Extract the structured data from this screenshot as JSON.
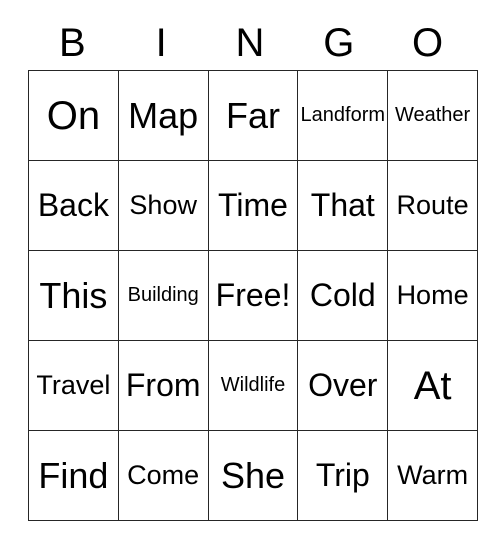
{
  "card": {
    "title": "BINGO",
    "header_letters": [
      "B",
      "I",
      "N",
      "G",
      "O"
    ],
    "border_color": "#262626",
    "background_color": "#ffffff",
    "text_color": "#000000",
    "rows": [
      [
        {
          "text": "On",
          "size": "xl"
        },
        {
          "text": "Map",
          "size": "lg"
        },
        {
          "text": "Far",
          "size": "lg"
        },
        {
          "text": "Landform",
          "size": "xs"
        },
        {
          "text": "Weather",
          "size": "xs"
        }
      ],
      [
        {
          "text": "Back",
          "size": "md"
        },
        {
          "text": "Show",
          "size": "sm"
        },
        {
          "text": "Time",
          "size": "md"
        },
        {
          "text": "That",
          "size": "md"
        },
        {
          "text": "Route",
          "size": "sm"
        }
      ],
      [
        {
          "text": "This",
          "size": "lg"
        },
        {
          "text": "Building",
          "size": "xs"
        },
        {
          "text": "Free!",
          "size": "md"
        },
        {
          "text": "Cold",
          "size": "md"
        },
        {
          "text": "Home",
          "size": "sm"
        }
      ],
      [
        {
          "text": "Travel",
          "size": "sm"
        },
        {
          "text": "From",
          "size": "md"
        },
        {
          "text": "Wildlife",
          "size": "xs"
        },
        {
          "text": "Over",
          "size": "md"
        },
        {
          "text": "At",
          "size": "xl"
        }
      ],
      [
        {
          "text": "Find",
          "size": "lg"
        },
        {
          "text": "Come",
          "size": "sm"
        },
        {
          "text": "She",
          "size": "lg"
        },
        {
          "text": "Trip",
          "size": "md"
        },
        {
          "text": "Warm",
          "size": "sm"
        }
      ]
    ],
    "free_space": {
      "row": 2,
      "col": 2,
      "label": "Free!"
    }
  }
}
